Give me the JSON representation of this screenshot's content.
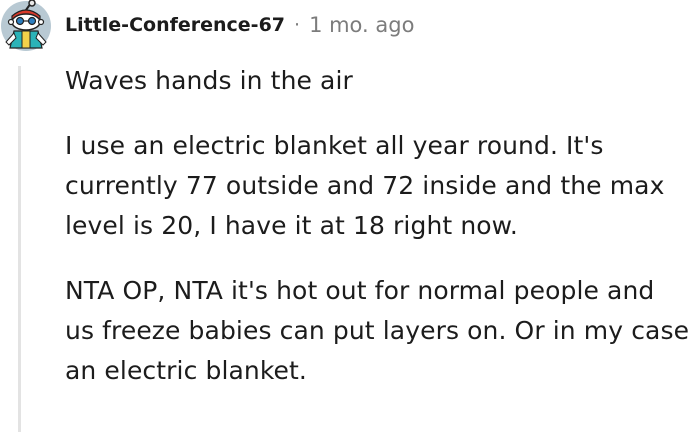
{
  "comment": {
    "author": "Little-Conference-67",
    "separator": "·",
    "timestamp": "1 mo. ago",
    "avatar_icon": "snoo-avatar-icon",
    "paragraphs": [
      "Waves hands in the air",
      "I use an electric blanket all year round. It's currently 77 outside and 72 inside and the max level is 20, I have it at 18 right now.",
      "NTA OP, NTA it's hot out for normal people and us freeze babies can put layers on. Or in my case an electric blanket."
    ]
  },
  "colors": {
    "text": "#1c1c1c",
    "meta": "#7c7c7c",
    "thread_line": "#e3e3e3",
    "avatar_bg": "#b8c9d3"
  }
}
